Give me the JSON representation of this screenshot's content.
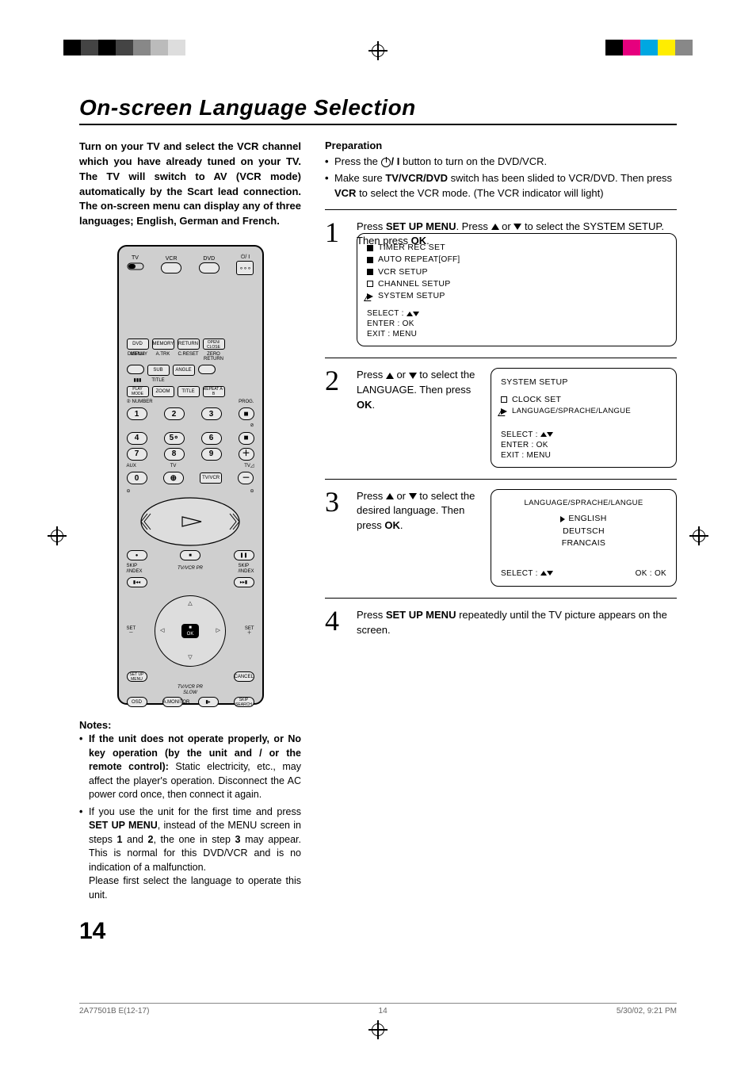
{
  "domain": "Document",
  "meta": {
    "title": "On-screen Language Selection",
    "page_number": "14",
    "footer_left": "2A77501B E(12-17)",
    "footer_center": "14",
    "footer_right": "5/30/02, 9:21 PM"
  },
  "intro": "Turn on your TV and select the VCR channel which you have already tuned on your TV. The TV will switch to AV (VCR mode) automatically by the Scart lead connection.  The on-screen menu can display any of three languages; English, German and French.",
  "remote": {
    "modes": {
      "tv": "TV",
      "vcr": "VCR",
      "dvd": "DVD"
    },
    "power": "⏻/ I",
    "row1": [
      "DVD MENU",
      "MEMORY",
      "RETURN",
      "OPEN/\nCLOSE"
    ],
    "row2_labels": [
      "DISPLAY",
      "A.TRK",
      "C.RESET",
      "ZERO RETURN"
    ],
    "row3": [
      "",
      "SUB TITLE",
      "ANGLE",
      ""
    ],
    "row4": [
      "PLAY\nMODE",
      "ZOOM",
      "TITLE",
      "REPEAT\nA-B"
    ],
    "numbers_label_left": "NUMBER",
    "numbers_label_right": "PROG.",
    "numbers": [
      "1",
      "2",
      "3",
      "4",
      "5",
      "6",
      "7",
      "8",
      "9",
      "0"
    ],
    "right_icons": [
      "■",
      "⊘",
      "■",
      "＋",
      "－"
    ],
    "aux": "AUX",
    "tv_label": "TV",
    "tvvcr": "TV/VCR",
    "skip_index_l": "SKIP\n/INDEX",
    "skip_index_r": "SKIP\n/INDEX",
    "tvvcr_pr": "TV/VCR PR",
    "set_l": "SET\n－",
    "set_r": "SET\n＋",
    "ok": "OK",
    "setup_menu": "SET UP\nMENU",
    "cancel": "CANCEL",
    "slow": "SLOW",
    "osd": "OSD",
    "amonitor": "A.MONITOR",
    "skip_search": "SKIP\nSEARCH"
  },
  "notes": {
    "heading": "Notes:",
    "items": [
      {
        "bold_prefix": "If the unit does not operate properly, or No key operation (by the unit and / or the remote control):",
        "rest": " Static electricity, etc., may affect the player's operation. Disconnect the AC power cord once, then connect it again."
      },
      {
        "bold_prefix": "",
        "rest_html": "If you use the unit for the first time and press <b>SET UP MENU</b>, instead of the MENU screen in steps <b>1</b> and <b>2</b>, the one in step <b>3</b> may appear. This is normal for this DVD/VCR and is no indication of a malfunction.\nPlease first select the language to operate this unit."
      }
    ]
  },
  "preparation": {
    "heading": "Preparation",
    "line1_pre": "Press the ",
    "line1_post": " button to turn on the DVD/VCR.",
    "line2_pre": "Make sure ",
    "line2_bold": "TV/VCR/DVD",
    "line2_mid": " switch has been slided to VCR/DVD. Then press ",
    "line2_bold2": "VCR",
    "line2_post": " to select the VCR mode. (The VCR indicator will light)"
  },
  "steps": {
    "s1": {
      "num": "1",
      "text_pre": "Press ",
      "text_b1": "SET UP MENU",
      "text_mid": ". Press ",
      "text_mid2": " or ",
      "text_post": " to select the SYSTEM SETUP.\nThen press ",
      "text_b2": "OK",
      "text_end": ".",
      "osd": {
        "items": [
          {
            "label": "TIMER  REC  SET",
            "marker": "filled",
            "right": ""
          },
          {
            "label": "AUTO  REPEAT",
            "marker": "filled",
            "right": "[OFF]"
          },
          {
            "label": "VCR SETUP",
            "marker": "filled",
            "right": ""
          },
          {
            "label": "CHANNEL  SETUP",
            "marker": "open",
            "right": ""
          },
          {
            "label": "SYSTEM  SETUP",
            "marker": "blink",
            "right": ""
          }
        ],
        "footer": {
          "select": "SELECT :",
          "enter": "ENTER   : OK",
          "exit": "EXIT       : MENU"
        }
      }
    },
    "s2": {
      "num": "2",
      "text_pre": "Press ",
      "text_mid": " or ",
      "text_post": " to select the LANGUAGE. Then press ",
      "text_b": "OK",
      "text_end": ".",
      "osd": {
        "title": "SYSTEM  SETUP",
        "items": [
          {
            "label": "CLOCK  SET",
            "marker": "open"
          },
          {
            "label": "LANGUAGE/SPRACHE/LANGUE",
            "marker": "blink"
          }
        ],
        "footer": {
          "select": "SELECT :",
          "enter": "ENTER   : OK",
          "exit": "EXIT       : MENU"
        }
      }
    },
    "s3": {
      "num": "3",
      "text_pre": "Press ",
      "text_mid": " or ",
      "text_post": " to select the desired language. Then press ",
      "text_b": "OK",
      "text_end": ".",
      "osd": {
        "title": "LANGUAGE/SPRACHE/LANGUE",
        "languages": [
          "ENGLISH",
          "DEUTSCH",
          "FRANCAIS"
        ],
        "selected_index": 0,
        "footer_left": "SELECT :",
        "footer_right": "OK : OK"
      }
    },
    "s4": {
      "num": "4",
      "text_pre": "Press ",
      "text_b": "SET UP MENU",
      "text_post": " repeatedly until the TV picture appears on the screen."
    }
  }
}
